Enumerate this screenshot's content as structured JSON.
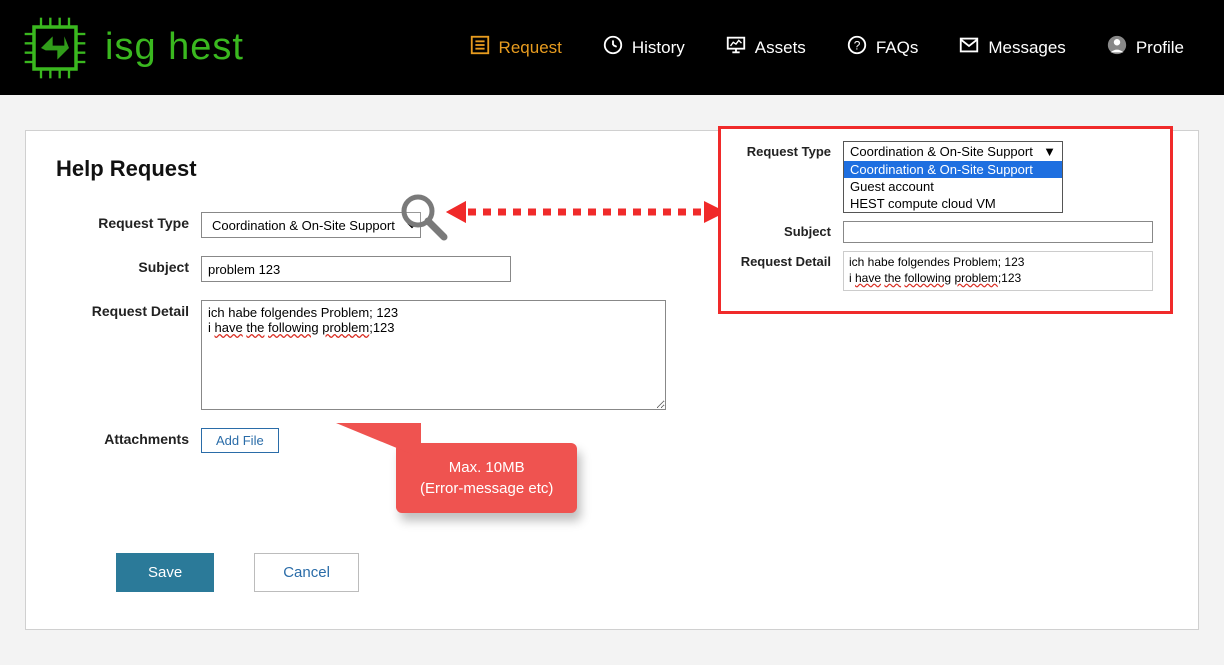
{
  "brand": "isg hest",
  "nav": {
    "request": "Request",
    "history": "History",
    "assets": "Assets",
    "faqs": "FAQs",
    "messages": "Messages",
    "profile": "Profile"
  },
  "page": {
    "title": "Help Request"
  },
  "form": {
    "request_type_label": "Request Type",
    "request_type_value": "Coordination & On-Site Support",
    "subject_label": "Subject",
    "subject_value": "problem 123",
    "detail_label": "Request Detail",
    "detail_line1": "ich habe folgendes Problem; 123",
    "detail_line2_pre_i": "i ",
    "detail_line2_have": "have",
    "detail_line2_sp1": " ",
    "detail_line2_the": "the",
    "detail_line2_sp2": " ",
    "detail_line2_following": "following",
    "detail_line2_sp3": " ",
    "detail_line2_problem": "problem",
    "detail_line2_tail": ";123",
    "attachments_label": "Attachments",
    "add_file": "Add File",
    "save": "Save",
    "cancel": "Cancel"
  },
  "callout": {
    "line1": "Max. 10MB",
    "line2": "(Error-message etc)"
  },
  "inset": {
    "request_type_label": "Request Type",
    "subject_label": "Subject",
    "detail_label": "Request Detail",
    "selected": "Coordination & On-Site Support",
    "options": {
      "o1": "Coordination & On-Site Support",
      "o2": "Guest account",
      "o3": "HEST compute cloud VM"
    },
    "detail_line1": "ich habe folgendes Problem; 123",
    "d2_pre": "i ",
    "d2_have": "have",
    "d2_s1": " ",
    "d2_the": "the",
    "d2_s2": " ",
    "d2_following": "following",
    "d2_s3": " ",
    "d2_problem": "problem",
    "d2_tail": ";123"
  }
}
